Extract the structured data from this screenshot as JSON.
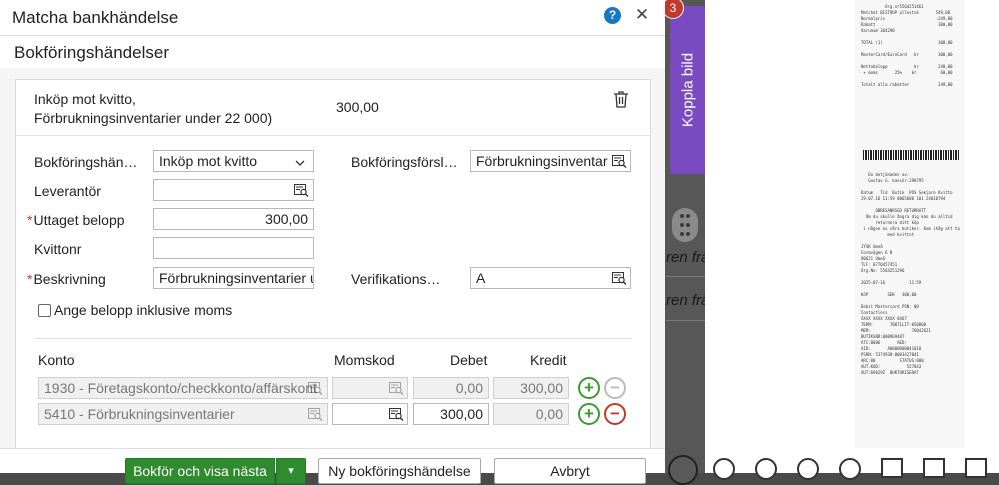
{
  "dialog": {
    "title": "Matcha bankhändelse",
    "help_label": "?",
    "close_label": "✕",
    "section_title": "Bokföringshändelser"
  },
  "summary": {
    "description_line1": "Inköp mot kvitto,",
    "description_line2": "Förbrukningsinventarier under 22 000)",
    "amount": "300,00"
  },
  "form": {
    "bokforingshandelse_label": "Bokföringshän…",
    "bokforingshandelse_value": "Inköp mot kvitto",
    "bokforingsforslag_label": "Bokföringsförsl…",
    "bokforingsforslag_value": "Förbrukningsinventar",
    "leverantor_label": "Leverantör",
    "leverantor_value": "",
    "uttaget_label": "Uttaget belopp",
    "uttaget_value": "300,00",
    "kvittonr_label": "Kvittonr",
    "kvittonr_value": "",
    "beskrivning_label": "Beskrivning",
    "beskrivning_value": "Förbrukningsinventarier u",
    "verifikations_label": "Verifikations…",
    "verifikations_value": "A",
    "moms_checkbox_label": "Ange belopp inklusive moms",
    "required_mark": "*"
  },
  "table": {
    "headers": {
      "konto": "Konto",
      "momskod": "Momskod",
      "debet": "Debet",
      "kredit": "Kredit"
    },
    "rows": [
      {
        "konto": "1930 - Företagskonto/checkkonto/affärskont",
        "momskod": "",
        "debet": "0,00",
        "kredit": "300,00"
      },
      {
        "konto": "5410 - Förbrukningsinventarier",
        "momskod": "",
        "debet": "300,00",
        "kredit": "0,00"
      }
    ],
    "add_label": "+",
    "remove_label": "−"
  },
  "footer": {
    "primary_label": "Bokför och visa nästa",
    "primary_split_label": "▾",
    "new_event_label": "Ny bokföringshändelse",
    "cancel_label": "Avbryt"
  },
  "side_panel": {
    "koppla_label": "Koppla bild",
    "badge_count": "3",
    "row_text_1": "ren från",
    "row_text_2": "ren från"
  },
  "colors": {
    "primary_green": "#2e8b2e",
    "accent_purple": "#7a4bc0",
    "help_blue": "#1677c9",
    "danger_red": "#c0392b"
  }
}
